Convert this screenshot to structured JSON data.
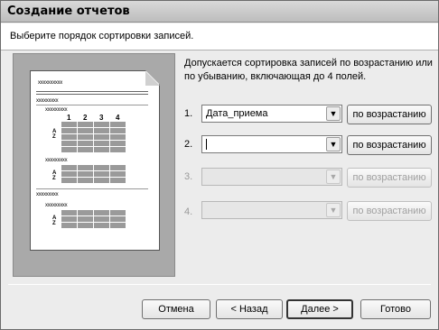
{
  "window": {
    "title": "Создание отчетов"
  },
  "instruction": "Выберите порядок сортировки записей.",
  "description": "Допускается сортировка записей по возрастанию или по убыванию, включающая до 4 полей.",
  "preview": {
    "header_text": "xxxxxxxxxx",
    "group_text": "xxxxxxxxx",
    "subgroup_text": "xxxxxxxxx",
    "column_numbers": [
      "1",
      "2",
      "3",
      "4"
    ],
    "az_label": "A Z"
  },
  "sort_fields": [
    {
      "number": "1.",
      "value": "Дата_приема",
      "order": "по возрастанию",
      "enabled": true
    },
    {
      "number": "2.",
      "value": "",
      "order": "по возрастанию",
      "enabled": true
    },
    {
      "number": "3.",
      "value": "",
      "order": "по возрастанию",
      "enabled": false
    },
    {
      "number": "4.",
      "value": "",
      "order": "по возрастанию",
      "enabled": false
    }
  ],
  "buttons": {
    "cancel": "Отмена",
    "back": "< Назад",
    "next": "Далее >",
    "finish": "Готово"
  }
}
